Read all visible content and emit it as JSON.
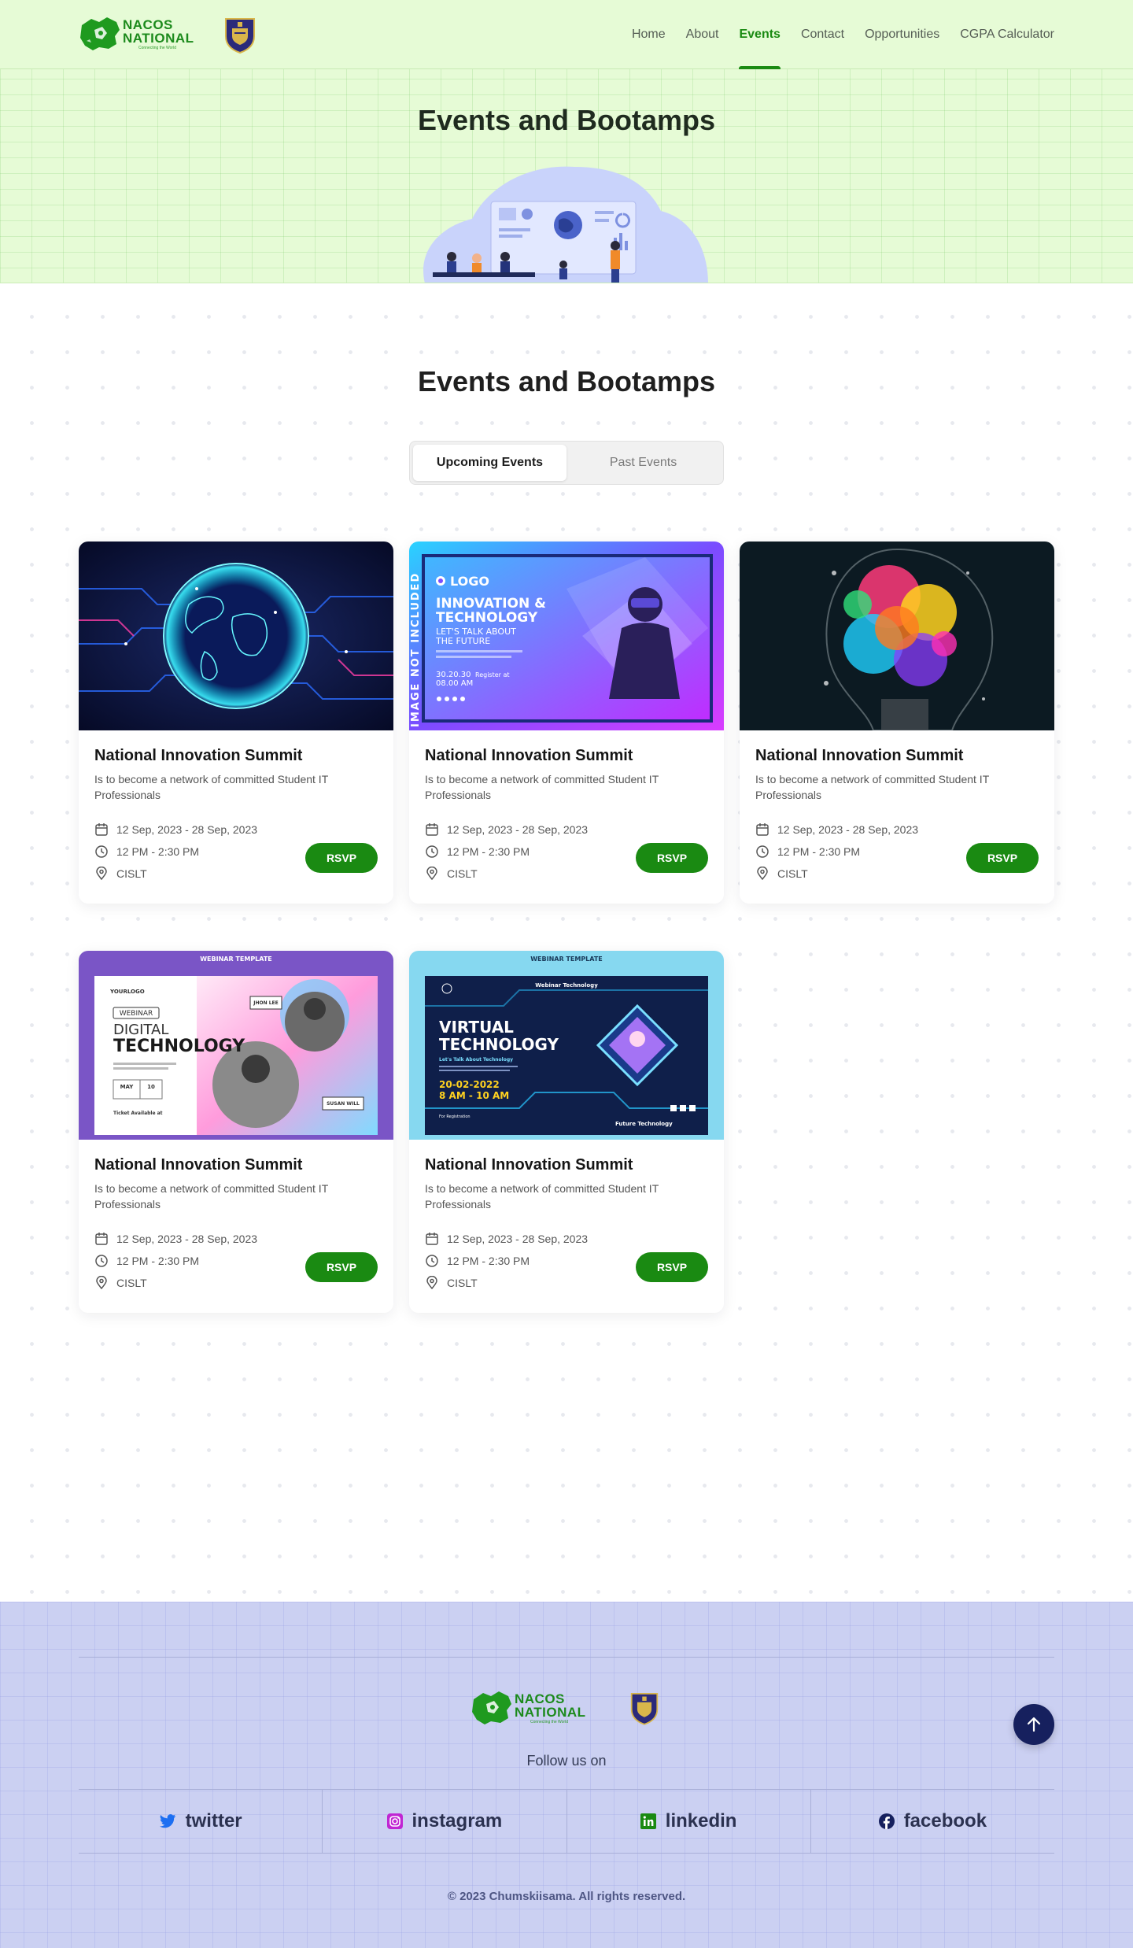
{
  "header": {
    "logo": {
      "line1": "NACOS",
      "line2": "NATIONAL",
      "tagline": "Connecting the World"
    },
    "nav": [
      {
        "label": "Home",
        "active": false
      },
      {
        "label": "About",
        "active": false
      },
      {
        "label": "Events",
        "active": true
      },
      {
        "label": "Contact",
        "active": false
      },
      {
        "label": "Opportunities",
        "active": false
      },
      {
        "label": "CGPA Calculator",
        "active": false
      }
    ]
  },
  "hero": {
    "title": "Events and Bootamps"
  },
  "main": {
    "title": "Events and Bootamps",
    "tabs": [
      {
        "label": "Upcoming Events",
        "active": true
      },
      {
        "label": "Past Events",
        "active": false
      }
    ],
    "events": [
      {
        "image": "globe-network",
        "title": "National Innovation Summit",
        "description": "Is to become a network of committed Student IT Professionals",
        "date": "12 Sep, 2023 - 28 Sep, 2023",
        "time": "12 PM - 2:30 PM",
        "location": "CISLT",
        "rsvp": "RSVP",
        "image_text": {
          "side": "",
          "logo": "",
          "h1": "",
          "h2": "",
          "sub1": "",
          "sub2": "",
          "date": "",
          "reg": "",
          "top": "",
          "h3": "",
          "h4": "",
          "tag": "",
          "time": "",
          "footer": "",
          "name1": "",
          "name2": "",
          "tagline": "",
          "month": "",
          "day": ""
        }
      },
      {
        "image": "innovation-technology-flyer",
        "title": "National Innovation Summit",
        "description": "Is to become a network of committed Student IT Professionals",
        "date": "12 Sep, 2023 - 28 Sep, 2023",
        "time": "12 PM - 2:30 PM",
        "location": "CISLT",
        "rsvp": "RSVP",
        "image_text": {
          "side": "IMAGE NOT INCLUDED",
          "logo": "LOGO",
          "h1": "INNOVATION &",
          "h2": "TECHNOLOGY",
          "sub1": "LET'S TALK ABOUT",
          "sub2": "THE FUTURE",
          "date": "30.20.30",
          "reg": "Register at",
          "top": "",
          "h3": "",
          "h4": "",
          "tag": "",
          "time": "08.00 AM",
          "footer": "",
          "name1": "",
          "name2": "",
          "tagline": "",
          "month": "",
          "day": ""
        }
      },
      {
        "image": "colorful-lightbulb",
        "title": "National Innovation Summit",
        "description": "Is to become a network of committed Student IT Professionals",
        "date": "12 Sep, 2023 - 28 Sep, 2023",
        "time": "12 PM - 2:30 PM",
        "location": "CISLT",
        "rsvp": "RSVP",
        "image_text": {
          "side": "",
          "logo": "",
          "h1": "",
          "h2": "",
          "sub1": "",
          "sub2": "",
          "date": "",
          "reg": "",
          "top": "",
          "h3": "",
          "h4": "",
          "tag": "",
          "time": "",
          "footer": "",
          "name1": "",
          "name2": "",
          "tagline": "",
          "month": "",
          "day": ""
        }
      },
      {
        "image": "digital-technology-webinar",
        "title": "National Innovation Summit",
        "description": "Is to become a network of committed Student IT Professionals",
        "date": "12 Sep, 2023 - 28 Sep, 2023",
        "time": "12 PM - 2:30 PM",
        "location": "CISLT",
        "rsvp": "RSVP",
        "image_text": {
          "side": "",
          "logo": "YOURLOGO",
          "h1": "DIGITAL",
          "h2": "TECHNOLOGY",
          "sub1": "WEBINAR",
          "sub2": "",
          "date": "",
          "reg": "Ticket Available at",
          "top": "WEBINAR TEMPLATE",
          "h3": "",
          "h4": "",
          "tag": "",
          "time": "",
          "footer": "",
          "name1": "JHON LEE",
          "name2": "SUSAN WILL",
          "tagline": "",
          "month": "MAY",
          "day": "10"
        }
      },
      {
        "image": "virtual-technology-webinar",
        "title": "National Innovation Summit",
        "description": "Is to become a network of committed Student IT Professionals",
        "date": "12 Sep, 2023 - 28 Sep, 2023",
        "time": "12 PM - 2:30 PM",
        "location": "CISLT",
        "rsvp": "RSVP",
        "image_text": {
          "side": "",
          "logo": "",
          "h1": "VIRTUAL",
          "h2": "TECHNOLOGY",
          "sub1": "Webinar Technology",
          "sub2": "Let's Talk About Technology",
          "date": "20-02-2022",
          "reg": "For Registration",
          "top": "WEBINAR TEMPLATE",
          "h3": "",
          "h4": "",
          "tag": "",
          "time": "8 AM - 10 AM",
          "footer": "Future Technology",
          "name1": "",
          "name2": "",
          "tagline": "",
          "month": "",
          "day": ""
        }
      }
    ]
  },
  "footer": {
    "logo": {
      "line1": "NACOS",
      "line2": "NATIONAL",
      "tagline": "Connecting the World"
    },
    "follow_label": "Follow us on",
    "socials": [
      {
        "label": "twitter",
        "icon": "twitter-icon",
        "color": "#1d6ff2"
      },
      {
        "label": "instagram",
        "icon": "instagram-icon",
        "color": "#c026d3"
      },
      {
        "label": "linkedin",
        "icon": "linkedin-icon",
        "color": "#1a8a12"
      },
      {
        "label": "facebook",
        "icon": "facebook-icon",
        "color": "#16205e"
      }
    ],
    "copyright": "© 2023 Chumskiisama. All rights reserved."
  },
  "colors": {
    "primary_green": "#1a8a12",
    "hero_bg": "#e6fbd6",
    "footer_bg": "#cbd0f2",
    "navy": "#16205e"
  }
}
